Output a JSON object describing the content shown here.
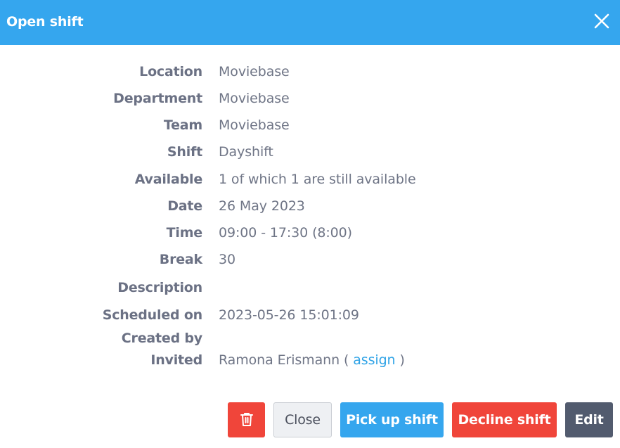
{
  "header": {
    "title": "Open shift",
    "close_icon": "close-icon",
    "bg_color": "#35a6ee"
  },
  "details": {
    "location": {
      "label": "Location",
      "value": "Moviebase"
    },
    "department": {
      "label": "Department",
      "value": "Moviebase"
    },
    "team": {
      "label": "Team",
      "value": "Moviebase"
    },
    "shift": {
      "label": "Shift",
      "value": "Dayshift"
    },
    "available": {
      "label": "Available",
      "value": "1 of which 1 are still available"
    },
    "date": {
      "label": "Date",
      "value": "26 May 2023"
    },
    "time": {
      "label": "Time",
      "value": "09:00 - 17:30 (8:00)"
    },
    "break": {
      "label": "Break",
      "value": "30"
    },
    "description": {
      "label": "Description",
      "value": ""
    },
    "scheduled_on": {
      "label": "Scheduled on",
      "value": "2023-05-26 15:01:09"
    },
    "created_by": {
      "label": "Created by",
      "value": ""
    },
    "invited": {
      "label": "Invited",
      "name": "Ramona Erismann",
      "paren_open": "(",
      "assign_label": "assign",
      "paren_close": ")"
    }
  },
  "footer": {
    "delete_icon": "trash-icon",
    "close_label": "Close",
    "pickup_label": "Pick up shift",
    "decline_label": "Decline shift",
    "edit_label": "Edit"
  },
  "colors": {
    "primary": "#35a6ee",
    "danger": "#f0453a",
    "dark": "#525b6e",
    "link": "#2fa3e6"
  }
}
